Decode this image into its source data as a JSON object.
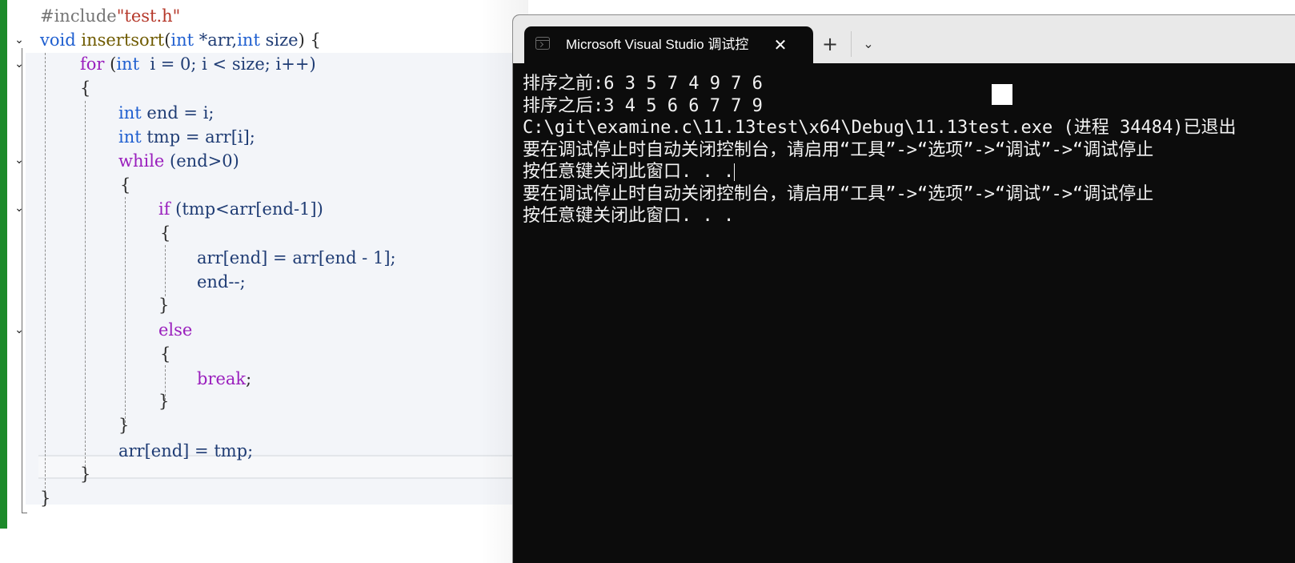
{
  "editor": {
    "code": {
      "include_directive": "#include",
      "include_file": "\"test.h\"",
      "func_ret": "void",
      "func_name": "insertsort",
      "func_params_open": "(",
      "param1_type": "int",
      "param1_name": " *arr,",
      "param2_type": "int",
      "param2_name": " size",
      "func_params_close": ") {",
      "for_kw": "for",
      "for_open": " (",
      "for_int": "int",
      "for_rest": "  i = 0; i < size; i++)",
      "brace_open": "{",
      "brace_close": "}",
      "end_decl_type": "int",
      "end_decl_rest": " end = i;",
      "tmp_decl_type": "int",
      "tmp_decl_rest": " tmp = arr[i];",
      "while_kw": "while",
      "while_rest": " (end>0)",
      "if_kw": "if",
      "if_rest": " (tmp<arr[end-1])",
      "shift_stmt": "arr[end] = arr[end - 1];",
      "decrement_stmt": "end--;",
      "else_kw": "else",
      "break_kw": "break",
      "break_semicolon": ";",
      "assign_stmt": "arr[end] = tmp;"
    }
  },
  "terminal": {
    "tab_title": "Microsoft Visual Studio 调试控",
    "close_symbol": "✕",
    "new_tab_symbol": "+",
    "dropdown_symbol": "⌄",
    "lines": [
      "排序之前:6 3 5 7 4 9 7 6",
      "排序之后:3 4 5 6 6 7 7 9",
      "C:\\git\\examine.c\\11.13test\\x64\\Debug\\11.13test.exe (进程 34484)已退出",
      "要在调试停止时自动关闭控制台，请启用“工具”->“选项”->“调试”->“调试停止",
      "按任意键关闭此窗口. . .",
      "要在调试停止时自动关闭控制台，请启用“工具”->“选项”->“调试”->“调试停止",
      "按任意键关闭此窗口. . ."
    ]
  },
  "colors": {
    "keyword": "#1f5fd0",
    "control_keyword": "#9a1fbd",
    "string": "#b5382a",
    "change_bar": "#1c8a2a",
    "console_bg": "#0c0c0c",
    "console_text": "#f2f2f2"
  },
  "icons": {
    "fold": "chevron-down-icon",
    "terminal_tab": "terminal-icon",
    "close": "close-icon",
    "add": "plus-icon",
    "dropdown": "chevron-down-icon"
  }
}
